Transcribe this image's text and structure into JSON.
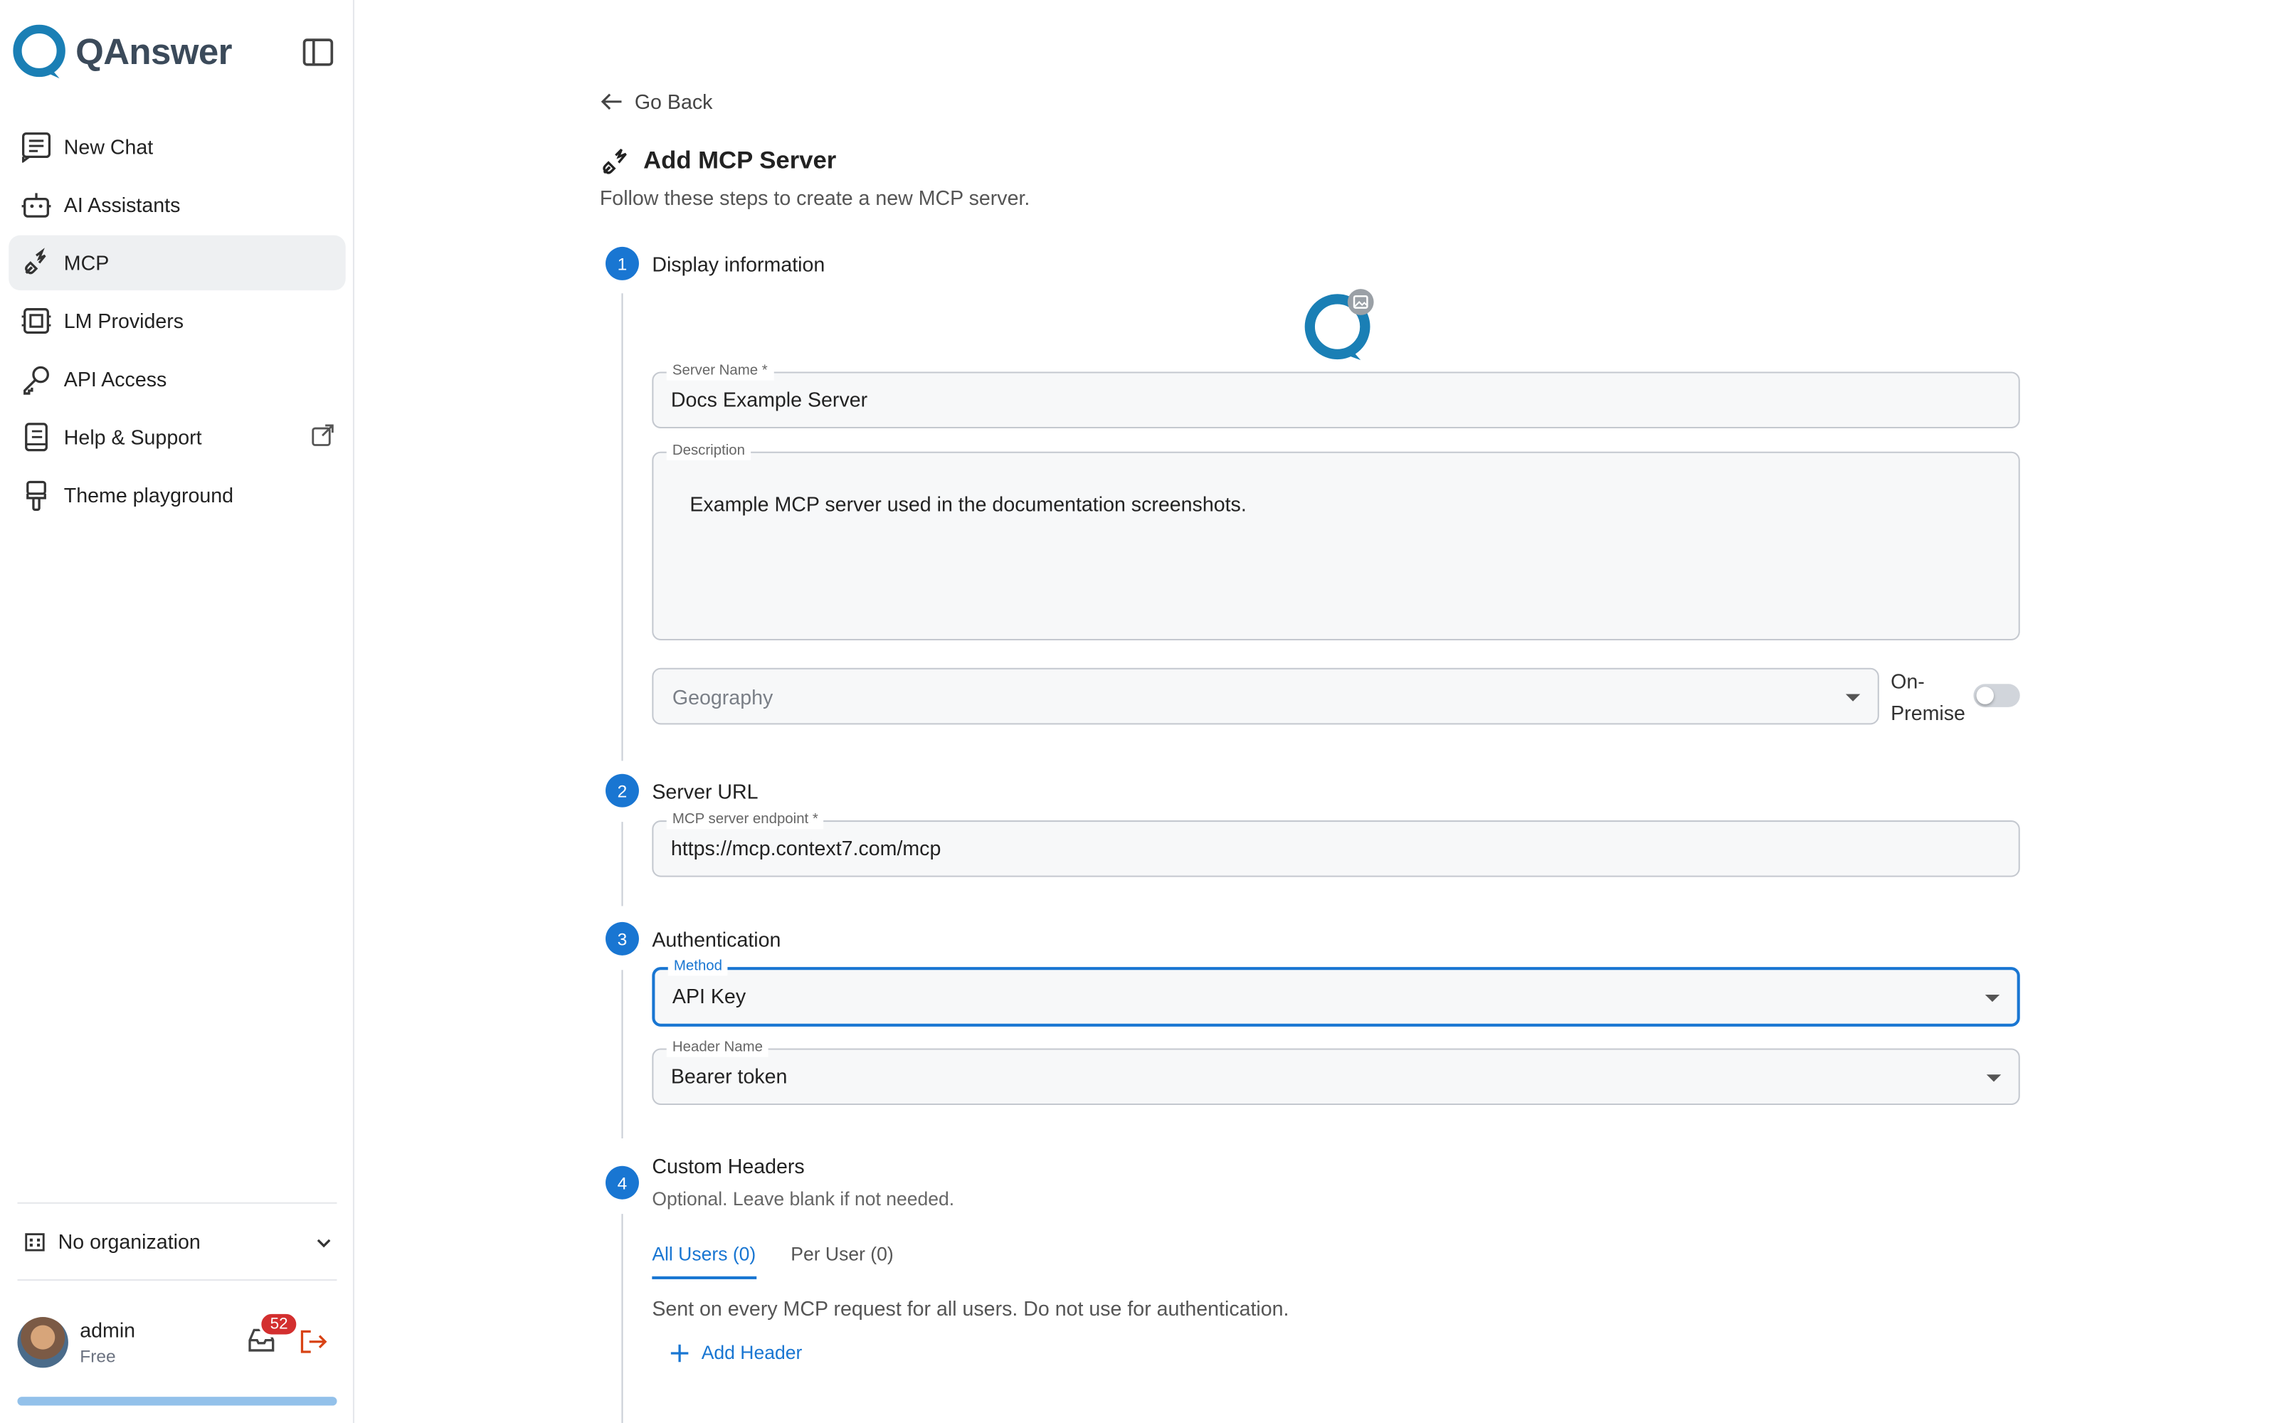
{
  "app": {
    "brand": "QAnswer",
    "accent": "#1976d2"
  },
  "sidebar": {
    "items": [
      {
        "label": "New Chat",
        "icon": "chat-icon"
      },
      {
        "label": "AI Assistants",
        "icon": "robot-icon"
      },
      {
        "label": "MCP",
        "icon": "plug-icon",
        "active": true
      },
      {
        "label": "LM Providers",
        "icon": "cpu-icon"
      },
      {
        "label": "API Access",
        "icon": "key-icon"
      },
      {
        "label": "Help & Support",
        "icon": "book-icon"
      },
      {
        "label": "Theme playground",
        "icon": "brush-icon"
      }
    ],
    "organization": "No organization",
    "user": {
      "name": "admin",
      "plan": "Free",
      "notifications": "52",
      "usage_fraction": 1.0
    }
  },
  "main": {
    "go_back": "Go Back",
    "title": "Add MCP Server",
    "subtitle": "Follow these steps to create a new MCP server.",
    "steps": [
      {
        "num": "1",
        "label": "Display information"
      },
      {
        "num": "2",
        "label": "Server URL"
      },
      {
        "num": "3",
        "label": "Authentication"
      },
      {
        "num": "4",
        "label": "Custom Headers",
        "hint": "Optional. Leave blank if not needed."
      }
    ],
    "display": {
      "server_name_label": "Server Name *",
      "server_name_value": "Docs Example Server",
      "description_label": "Description",
      "description_value": "Example MCP server used in the documentation screenshots.",
      "geography_placeholder": "Geography",
      "on_premise_label_1": "On-",
      "on_premise_label_2": "Premise",
      "on_premise_enabled": false
    },
    "server_url": {
      "label": "MCP server endpoint *",
      "value": "https://mcp.context7.com/mcp"
    },
    "auth": {
      "method_label": "Method",
      "method_value": "API Key",
      "header_label": "Header Name",
      "header_value": "Bearer token"
    },
    "custom_headers": {
      "tabs": [
        {
          "label": "All Users (0)",
          "active": true
        },
        {
          "label": "Per User (0)",
          "active": false
        }
      ],
      "description": "Sent on every MCP request for all users. Do not use for authentication.",
      "add_label": "Add Header"
    }
  }
}
